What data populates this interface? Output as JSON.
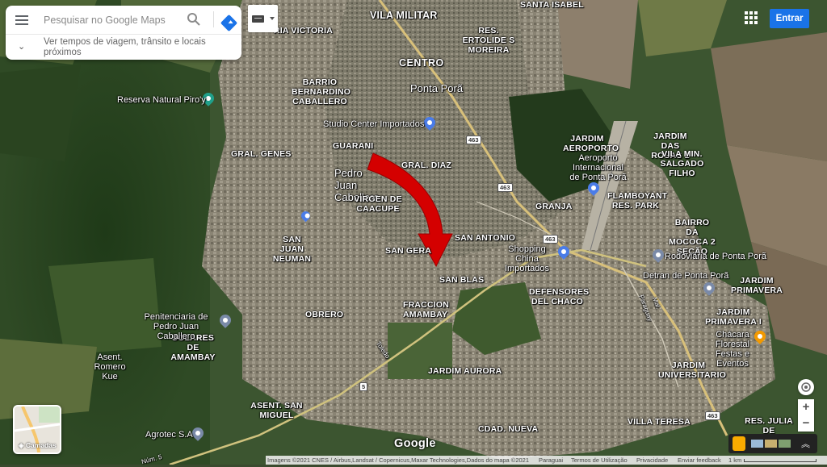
{
  "search": {
    "placeholder": "Pesquisar no Google Maps",
    "hint": "Ver tempos de viagem, trânsito e locais próximos"
  },
  "header": {
    "signin_label": "Entrar"
  },
  "layers": {
    "label": "Camadas"
  },
  "logo": "Google",
  "footer": {
    "imagery": "Imagens ©2021 CNES / Airbus,Landsat / Copernicus,Maxar Technologies,Dados do mapa ©2021",
    "country": "Paraguai",
    "terms": "Termos de Utilização",
    "privacy": "Privacidade",
    "feedback": "Enviar feedback",
    "scale": "1 km"
  },
  "controls": {
    "zoom_in": "+",
    "zoom_out": "−"
  },
  "map": {
    "districts": {
      "vila_militar": "VILA MILITAR",
      "santa_isabel": "SANTA ISABEL",
      "maria_victoria": "RIA VICTORIA",
      "ertolide": "RES. ERTOLIDE S MOREIRA",
      "centro": "CENTRO",
      "ponta_pora": "Ponta Porã",
      "bernardino": "BARRIO BERNARDINO CABALLERO",
      "gral_genes": "GRAL. GENES",
      "guarani": "GUARANI",
      "pedro_juan": "Pedro Juan Caballero",
      "gral_diaz": "GRAL. DIAZ",
      "virgen": "VIRGEN DE CAACUPE",
      "san_juan_neuman": "SAN JUAN NEUMAN",
      "san_antonio": "SAN ANTONIO",
      "san_gerardo": "SAN GERA",
      "san_blas": "SAN BLAS",
      "granja": "GRANJA",
      "jardim_aeroporto": "JARDIM AEROPORTO",
      "jardim_das_rosas": "JARDIM DAS ROSAS 2",
      "vila_min": "VILA MIN. SALGADO FILHO",
      "flamboyant": "FLAMBOYANT RES. PARK",
      "mococa": "BAIRRO DA MOCOCA 2 SEÇÃO",
      "defensores": "DEFENSORES DEL CHACO",
      "obrero": "OBRERO",
      "fraccion": "FRACCION AMAMBAY",
      "solares": "SOLARES DE AMAMBAY",
      "jardim_primavera": "JARDIM PRIMAVERA",
      "jardim_primavera_i": "JARDIM PRIMAVERA I",
      "jardim_aurora": "JARDIM AURORA",
      "jardim_universitario": "JARDIM UNIVERSITARIO",
      "asent_san_miguel": "ASENT. SAN MIGUEL",
      "cdad_nueva": "CDAD. NUEVA",
      "villa_teresa": "VILLA TERESA",
      "res_julia": "RES. JULIA DE OLIVEIRA",
      "asent_romero": "Asent. Romero Kue"
    },
    "pois": {
      "reserva": "Reserva Natural Piro'y",
      "studio": "Studio Center Importados",
      "aeroporto": "Aeroporto Internacional de Ponta Porã",
      "shopping": "Shopping China Importados",
      "rodoviaria": "Rodoviária de Ponta Porã",
      "detran": "Detran de Ponta Porã",
      "chacara": "Chácara Florestal Festas e Eventos",
      "penitenciaria": "Penitenciaria de Pedro Juan Caballero",
      "agrotec": "Agrotec S.A"
    },
    "roads": {
      "r463a": "463",
      "r463b": "463",
      "r463c": "463",
      "r5": "5",
      "r5b": "5",
      "r463d": "463",
      "toledo": "Toledo",
      "paraguay": "Paraguay",
      "mal": "Mal.",
      "num5": "Núm. 5"
    }
  },
  "colors": {
    "accent": "#1a73e8",
    "arrow": "#d40000"
  }
}
